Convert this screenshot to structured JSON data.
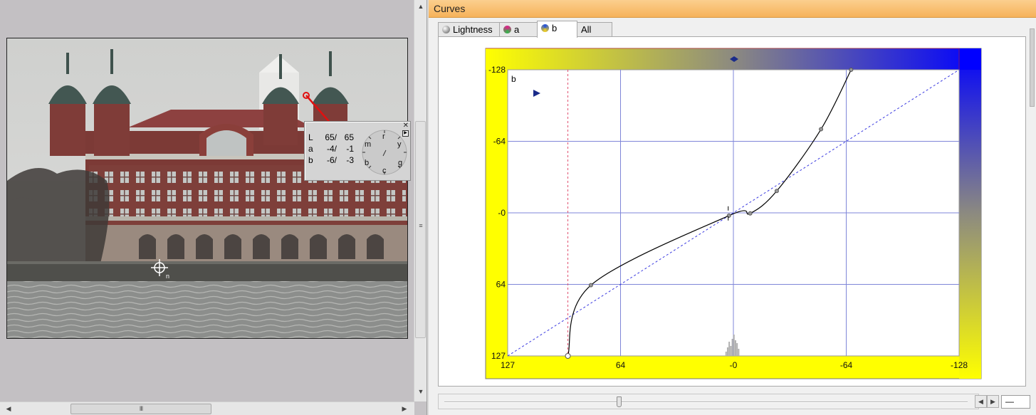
{
  "image_viewer": {
    "readout": {
      "rows": [
        {
          "channel": "L",
          "v1": "65/",
          "v2": "65"
        },
        {
          "channel": "a",
          "v1": "-4/",
          "v2": "-1"
        },
        {
          "channel": "b",
          "v1": "-6/",
          "v2": "-3"
        }
      ],
      "dial_labels": {
        "r": "r",
        "y": "y",
        "g": "g",
        "c": "c",
        "b": "b",
        "m": "m"
      },
      "close_glyph": "✕",
      "expand_glyph": "▶"
    },
    "marker_label": "n",
    "h_thumb_grip": "III",
    "v_thumb_grip": "≡",
    "scroll_left": "◀",
    "scroll_right": "▶",
    "scroll_up": "▲",
    "scroll_down": "▼"
  },
  "curves_panel": {
    "title": "Curves",
    "tabs": [
      {
        "label": "Lightness",
        "icon": "lightness-ball-icon"
      },
      {
        "label": "a",
        "icon": "a-ball-icon"
      },
      {
        "label": "b",
        "icon": "b-ball-icon",
        "active": true
      },
      {
        "label": "All",
        "icon": ""
      }
    ],
    "graph": {
      "channel_label": "b",
      "axis_x_ticks": [
        "127",
        "64",
        "-0",
        "-64",
        "-128"
      ],
      "axis_y_ticks": [
        "-128",
        "-64",
        "-0",
        "64",
        "127"
      ],
      "x_range": [
        127,
        -128
      ],
      "y_range": [
        127,
        -128
      ],
      "curve_points": [
        {
          "x": 93,
          "y": 127
        },
        {
          "x": 80,
          "y": 64
        },
        {
          "x": 2,
          "y": 2
        },
        {
          "x": -10,
          "y": 0
        },
        {
          "x": -25,
          "y": -20
        },
        {
          "x": -50,
          "y": -75
        },
        {
          "x": -67,
          "y": -128
        }
      ],
      "gradient_colors": {
        "yellow": "#ffff00",
        "blue": "#0000ff",
        "grid": "#7f86d8",
        "diagonal": "#3a3ae0"
      },
      "marker_color": "#1a2b8a"
    },
    "slider_value_box": "—",
    "nav_prev": "◀",
    "nav_next": "▶"
  }
}
